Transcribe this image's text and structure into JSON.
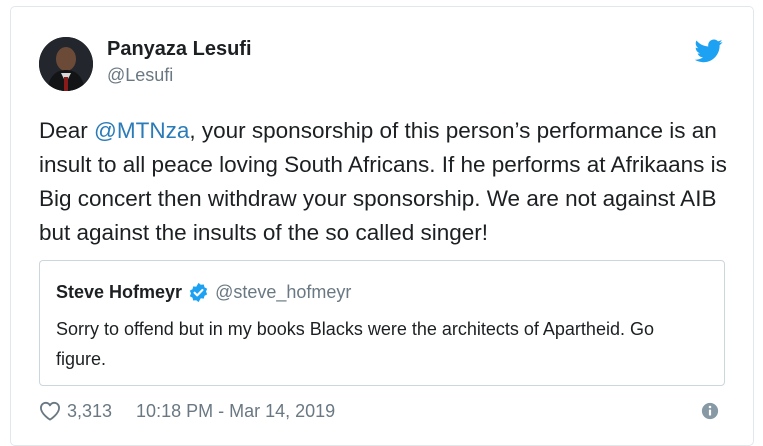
{
  "author": {
    "name": "Panyaza Lesufi",
    "handle": "@Lesufi"
  },
  "tweet": {
    "text_before_mention": "Dear ",
    "mention": "@MTNza",
    "text_after_mention": ", your sponsorship of this person’s performance is an insult to all peace loving South Africans. If he performs at Afrikaans is Big concert then withdraw your sponsorship. We are not against AIB but against the insults of the so called singer!"
  },
  "quoted_tweet": {
    "name": "Steve Hofmeyr",
    "handle": "@steve_hofmeyr",
    "text": "Sorry to offend but in my books Blacks were the architects of Apartheid. Go figure."
  },
  "footer": {
    "like_count": "3,313",
    "timestamp": "10:18 PM - Mar 14, 2019"
  },
  "icons": {
    "brand": "twitter-bird-icon",
    "verified": "verified-badge-icon",
    "like": "heart-icon",
    "info": "info-icon"
  },
  "colors": {
    "accent": "#1da1f2",
    "mention": "#2b7bb9",
    "muted_text": "#697882",
    "border": "#e1e8ed"
  }
}
